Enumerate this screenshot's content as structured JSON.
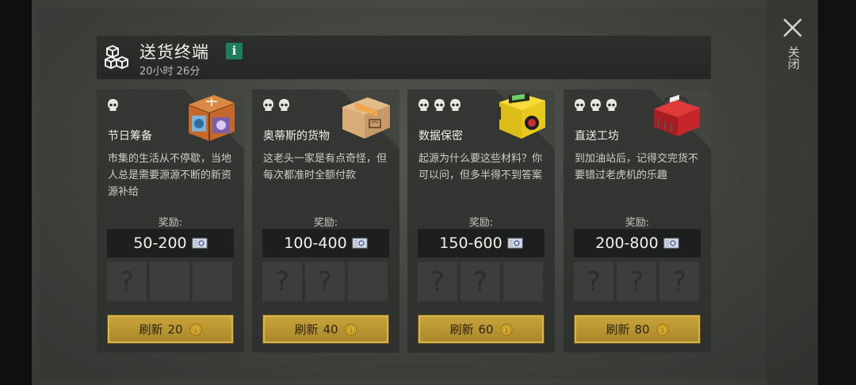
{
  "header": {
    "title": "送货终端",
    "info_icon": "i",
    "timer": "20小时 26分"
  },
  "close_label": "关闭",
  "cards": [
    {
      "name": "节日筹备",
      "danger_level": 1,
      "description": "市集的生活从不停歇，当地人总是需要源源不断的新资源补给",
      "reward_label": "奖励:",
      "reward_range": "50-200",
      "slots": [
        "?",
        "",
        ""
      ],
      "refresh_label": "刷新",
      "refresh_cost": "20",
      "art_icon": "festival-crate-icon"
    },
    {
      "name": "奥蒂斯的货物",
      "danger_level": 2,
      "description": "这老头一家是有点奇怪，但每次都准时全额付款",
      "reward_label": "奖励:",
      "reward_range": "100-400",
      "slots": [
        "?",
        "?",
        ""
      ],
      "refresh_label": "刷新",
      "refresh_cost": "40",
      "art_icon": "cardboard-box-icon"
    },
    {
      "name": "数据保密",
      "danger_level": 3,
      "description": "起源为什么要这些材料？你可以问，但多半得不到答案",
      "reward_label": "奖励:",
      "reward_range": "150-600",
      "slots": [
        "?",
        "?",
        ""
      ],
      "refresh_label": "刷新",
      "refresh_cost": "60",
      "art_icon": "biohazard-case-icon"
    },
    {
      "name": "直送工坊",
      "danger_level": 3,
      "description": "到加油站后，记得交完货不要错过老虎机的乐趣",
      "reward_label": "奖励:",
      "reward_range": "200-800",
      "slots": [
        "?",
        "?",
        "?"
      ],
      "refresh_label": "刷新",
      "refresh_cost": "80",
      "art_icon": "red-toolbox-icon"
    }
  ],
  "colors": {
    "button_gold": "#c9a53a",
    "badge_green": "#1e7d5c",
    "panel_dark": "#2f312f"
  }
}
